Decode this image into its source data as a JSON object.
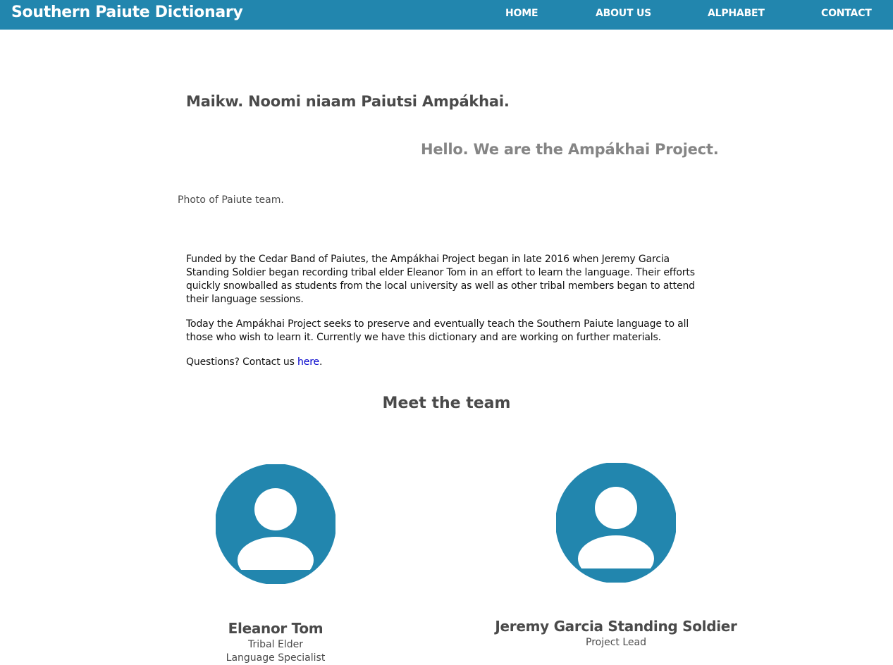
{
  "navbar": {
    "brand": "Southern Paiute Dictionary",
    "links": [
      {
        "label": "HOME"
      },
      {
        "label": "ABOUT US"
      },
      {
        "label": "ALPHABET"
      },
      {
        "label": "CONTACT"
      }
    ],
    "color": "#2286ae"
  },
  "intro": {
    "heading_paiute": "Maikw. Noomi niaam Paiutsi Ampákhai.",
    "heading_english": "Hello. We are the Ampákhai Project.",
    "photo_alt": "Photo of Paiute team."
  },
  "about": {
    "paragraph1": "Funded by the Cedar Band of Paiutes, the Ampákhai Project began in late 2016 when Jeremy Garcia Standing Soldier began recording tribal elder Eleanor Tom in an effort to learn the language. Their efforts quickly snowballed as students from the local university as well as other tribal members began to attend their language sessions.",
    "paragraph2": "Today the Ampákhai Project seeks to preserve and eventually teach the Southern Paiute language to all those who wish to learn it. Currently we have this dictionary and are working on further materials.",
    "contact_prefix": "Questions? Contact us ",
    "contact_link": "here",
    "contact_suffix": "."
  },
  "team": {
    "heading": "Meet the team",
    "members": [
      {
        "name": "Eleanor Tom",
        "role1": "Tribal Elder",
        "role2": "Language Specialist",
        "avatar_icon": "user-avatar-icon"
      },
      {
        "name": "Jeremy Garcia Standing Soldier",
        "role1": "Project Lead",
        "avatar_icon": "user-avatar-icon"
      }
    ]
  }
}
